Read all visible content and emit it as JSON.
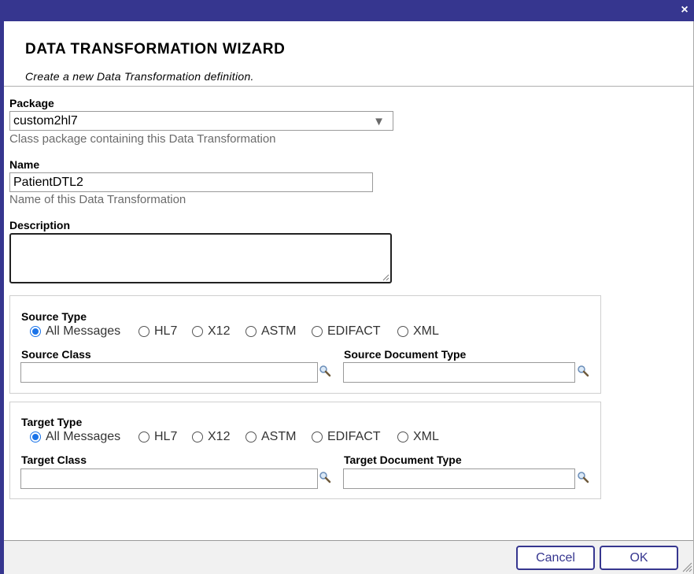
{
  "window": {
    "close_glyph": "×"
  },
  "header": {
    "title": "DATA TRANSFORMATION WIZARD",
    "subtitle": "Create a new Data Transformation definition."
  },
  "package": {
    "label": "Package",
    "value": "custom2hl7",
    "hint": "Class package containing this Data Transformation",
    "arrow_glyph": "▼"
  },
  "name": {
    "label": "Name",
    "value": "PatientDTL2",
    "hint": "Name of this Data Transformation"
  },
  "description": {
    "label": "Description",
    "value": ""
  },
  "source": {
    "type_label": "Source Type",
    "options": [
      "All Messages",
      "HL7",
      "X12",
      "ASTM",
      "EDIFACT",
      "XML"
    ],
    "selected": "All Messages",
    "class_label": "Source Class",
    "class_value": "",
    "doctype_label": "Source Document Type",
    "doctype_value": ""
  },
  "target": {
    "type_label": "Target Type",
    "options": [
      "All Messages",
      "HL7",
      "X12",
      "ASTM",
      "EDIFACT",
      "XML"
    ],
    "selected": "All Messages",
    "class_label": "Target Class",
    "class_value": "",
    "doctype_label": "Target Document Type",
    "doctype_value": ""
  },
  "buttons": {
    "cancel": "Cancel",
    "ok": "OK"
  },
  "colors": {
    "titlebar": "#36368f",
    "radio_checked": "#1a73e8",
    "button_border": "#36368f"
  }
}
